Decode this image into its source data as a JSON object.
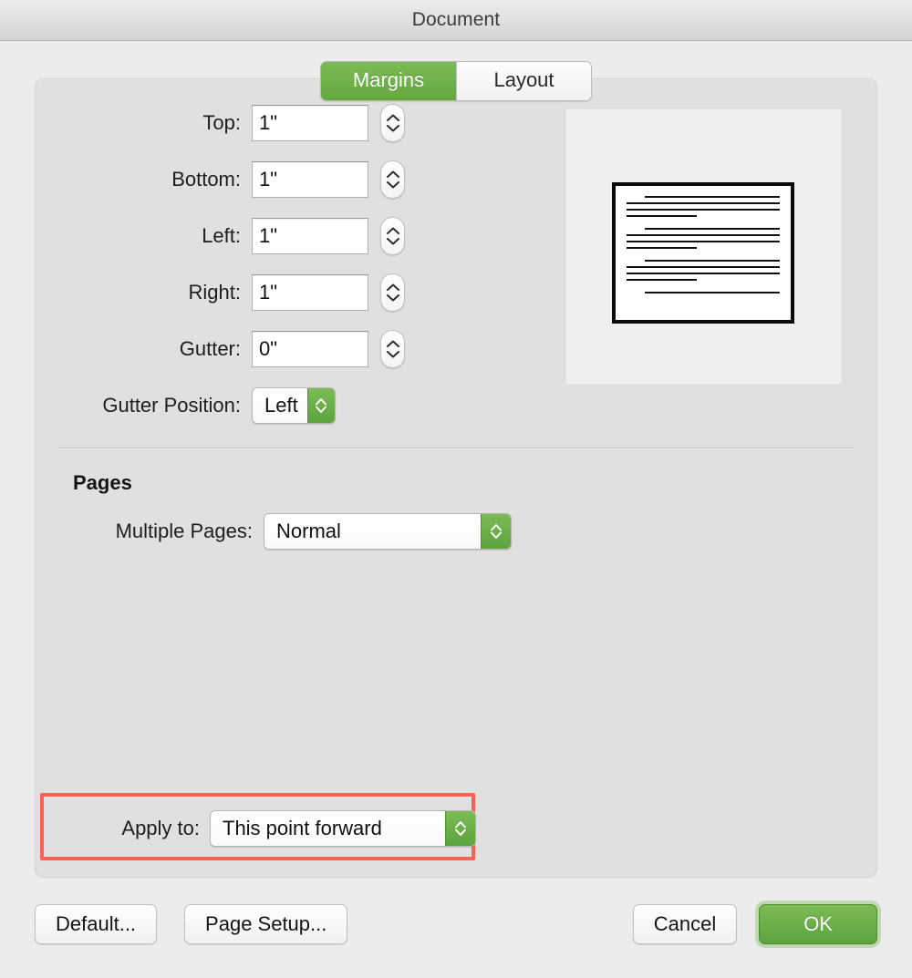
{
  "window": {
    "title": "Document"
  },
  "tabs": [
    {
      "label": "Margins",
      "active": true
    },
    {
      "label": "Layout",
      "active": false
    }
  ],
  "margins": {
    "fields": [
      {
        "label": "Top:",
        "value": "1\""
      },
      {
        "label": "Bottom:",
        "value": "1\""
      },
      {
        "label": "Left:",
        "value": "1\""
      },
      {
        "label": "Right:",
        "value": "1\""
      },
      {
        "label": "Gutter:",
        "value": "0\""
      }
    ],
    "gutter_position": {
      "label": "Gutter Position:",
      "value": "Left"
    }
  },
  "pages": {
    "section_title": "Pages",
    "multiple_pages": {
      "label": "Multiple Pages:",
      "value": "Normal"
    }
  },
  "apply_to": {
    "label": "Apply to:",
    "value": "This point forward",
    "highlighted": true,
    "highlight_color": "#fa6152"
  },
  "footer": {
    "default_label": "Default...",
    "page_setup_label": "Page Setup...",
    "cancel_label": "Cancel",
    "ok_label": "OK"
  },
  "colors": {
    "accent_green": "#63a83f",
    "window_background": "#ececec",
    "panel_background": "#e0e0e0",
    "annotation_red": "#fa6152"
  }
}
